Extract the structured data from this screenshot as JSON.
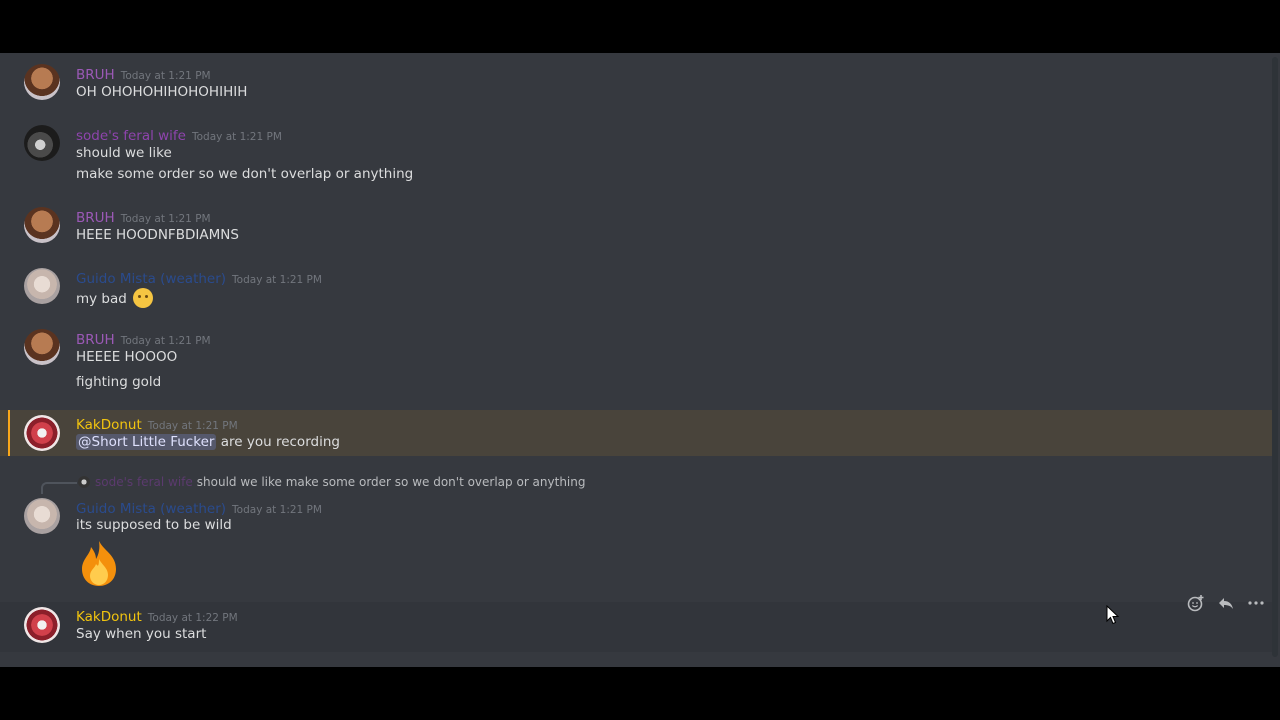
{
  "messages": [
    {
      "user": "BRUH",
      "time": "Today at 1:21 PM",
      "lines": [
        "OH OHOHOHIHOHOHIHIH"
      ]
    },
    {
      "user": "sode's feral wife",
      "time": "Today at 1:21 PM",
      "lines": [
        "should we like",
        "make some order so we don't overlap or anything"
      ]
    },
    {
      "user": "BRUH",
      "time": "Today at 1:21 PM",
      "lines": [
        "HEEE HOODNFBDIAMNS"
      ]
    },
    {
      "user": "Guido Mista (weather)",
      "time": "Today at 1:21 PM",
      "lines": [
        "my bad"
      ],
      "emoji": "confused-face-emoji"
    },
    {
      "user": "BRUH",
      "time": "Today at 1:21 PM",
      "lines": [
        "HEEEE HOOOO",
        "fighting gold"
      ]
    },
    {
      "user": "KakDonut",
      "time": "Today at 1:21 PM",
      "mention": "@Short Little Fucker",
      "lines": [
        " are you recording"
      ]
    },
    {
      "reply": {
        "user": "sode's feral wife",
        "text": "should we like make some order so we don't overlap or anything"
      },
      "user": "Guido Mista (weather)",
      "time": "Today at 1:21 PM",
      "lines": [
        "its supposed to be wild"
      ],
      "emoji": "fire-emoji"
    },
    {
      "user": "KakDonut",
      "time": "Today at 1:22 PM",
      "lines": [
        "Say when you start"
      ]
    }
  ],
  "toolbar": {
    "icons": [
      "add-reaction-icon",
      "reply-icon",
      "more-icon"
    ]
  },
  "colors": {
    "mention_bg": "#faa81a",
    "chat_bg": "#36393f"
  }
}
